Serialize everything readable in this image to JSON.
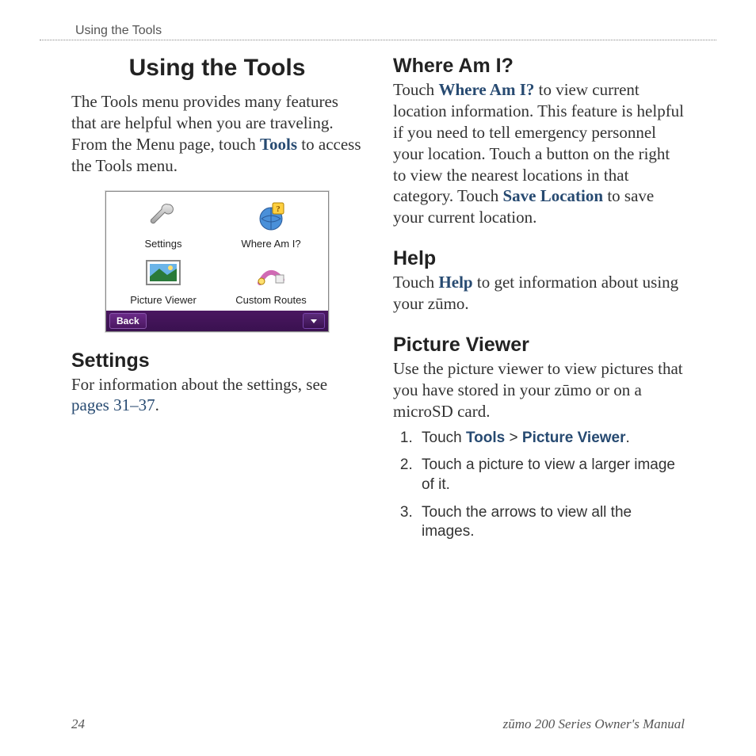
{
  "runningHead": "Using the Tools",
  "leftCol": {
    "title": "Using the Tools",
    "intro_a": "The Tools menu provides many features that are helpful when you are traveling. From the Menu page, touch ",
    "intro_tools": "Tools",
    "intro_b": " to access the Tools menu.",
    "settings_h": "Settings",
    "settings_a": "For information about the settings, see ",
    "settings_link": "pages 31–37",
    "settings_b": "."
  },
  "device": {
    "settings": "Settings",
    "where": "Where Am I?",
    "picture": "Picture Viewer",
    "custom": "Custom Routes",
    "back": "Back"
  },
  "rightCol": {
    "where_h": "Where Am I?",
    "where_a": "Touch ",
    "where_link": "Where Am I?",
    "where_b": " to view current location information. This feature is helpful if you need to tell emergency personnel your location. Touch a button on the right to view the nearest locations in that category. Touch ",
    "where_save": "Save Location",
    "where_c": " to save your current location.",
    "help_h": "Help",
    "help_a": "Touch ",
    "help_link": "Help",
    "help_b": " to get information about using your zūmo.",
    "pv_h": "Picture Viewer",
    "pv_body": "Use the picture viewer to view pictures that you have stored in your zūmo or on a microSD card.",
    "steps": {
      "s1_a": "Touch ",
      "s1_tools": "Tools",
      "s1_gt": " > ",
      "s1_pv": "Picture Viewer",
      "s1_b": ".",
      "s2": "Touch a picture to view a larger image of it.",
      "s3": "Touch the arrows to view all the images."
    }
  },
  "footer": {
    "page": "24",
    "manual": "zūmo 200 Series Owner's Manual"
  }
}
